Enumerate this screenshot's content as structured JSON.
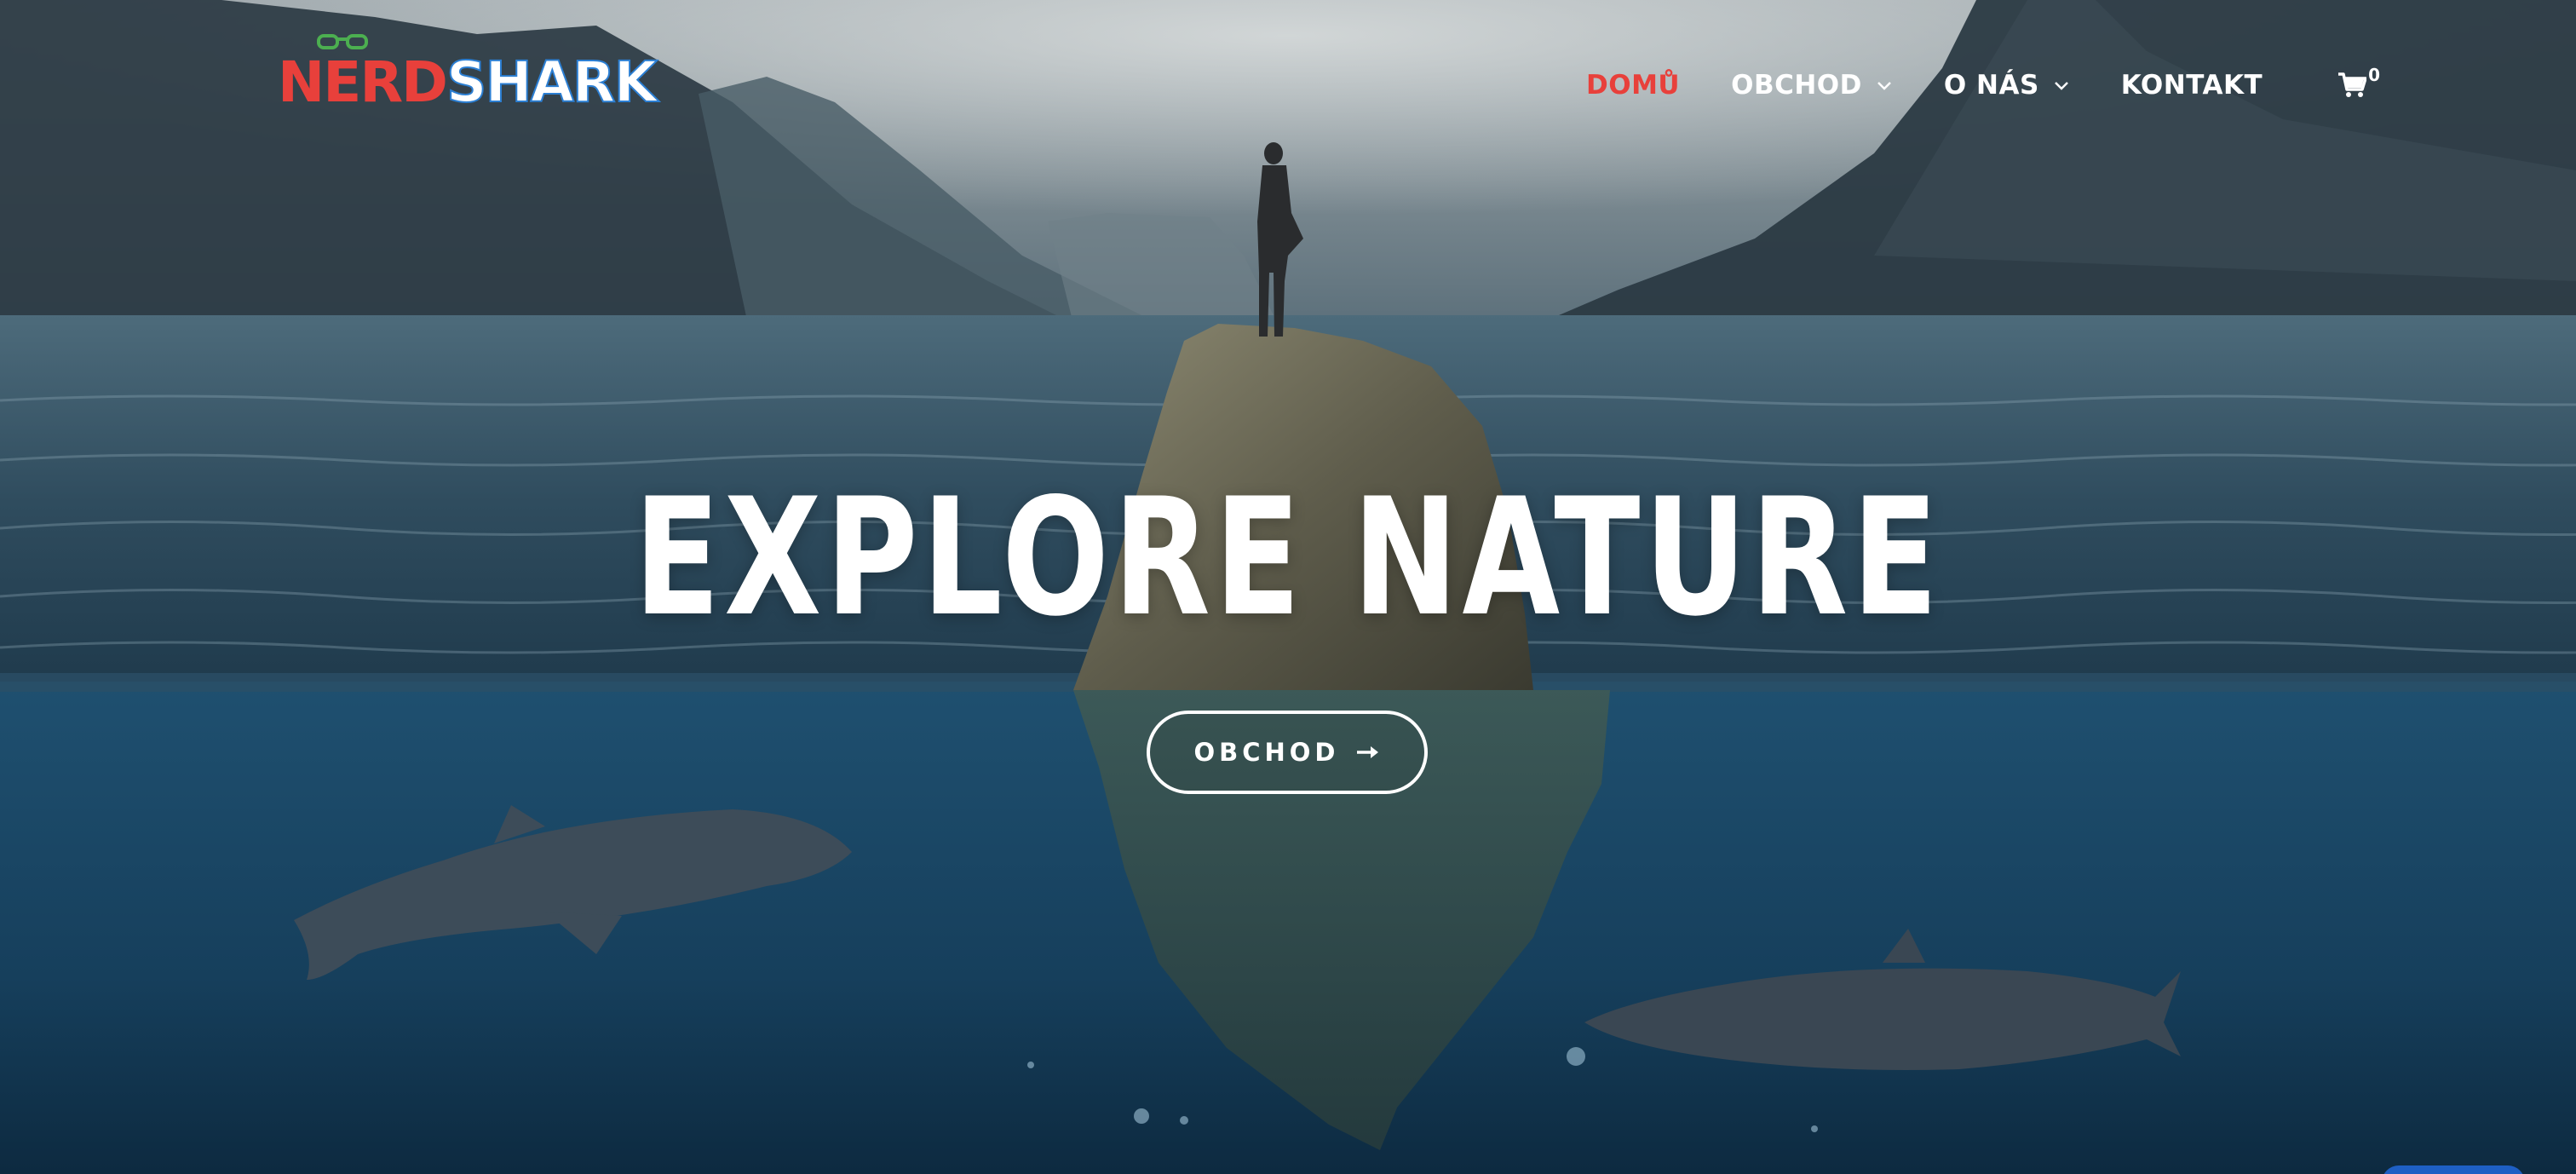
{
  "header": {
    "logo": {
      "part_a": "NERD",
      "part_b": "SHARK",
      "colors": {
        "red": "#e8403b",
        "blue": "#2c7fd3",
        "green": "#4caf50"
      }
    },
    "nav": {
      "items": [
        {
          "label": "DOMŮ",
          "active": true,
          "dropdown": false
        },
        {
          "label": "OBCHOD",
          "active": false,
          "dropdown": true
        },
        {
          "label": "O NÁS",
          "active": false,
          "dropdown": true
        },
        {
          "label": "KONTAKT",
          "active": false,
          "dropdown": false
        }
      ],
      "active_color": "#e8403b",
      "cart": {
        "icon": "shopping-cart-icon",
        "count": "0"
      }
    }
  },
  "hero": {
    "headline": "EXPLORE NATURE",
    "cta": {
      "label": "OBCHOD",
      "icon": "arrow-right-icon"
    },
    "background_description_colors": {
      "sky": "#8e9aa1",
      "sea_surface": "#3a5a6c",
      "underwater": "#1d4e6f"
    }
  },
  "chat_widget": {
    "color": "#1e5fc4"
  }
}
